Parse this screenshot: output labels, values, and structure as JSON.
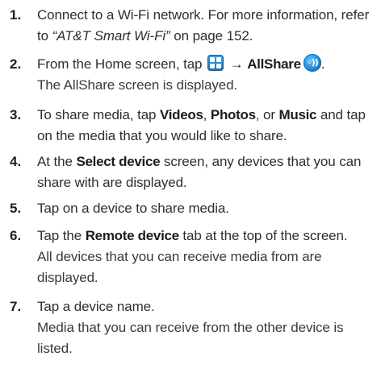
{
  "steps": [
    {
      "number": "1.",
      "line1": "Connect to a Wi-Fi network. For more information, refer",
      "line2_prefix": "to ",
      "line2_link": "“AT&T Smart Wi-Fi”",
      "line2_suffix": " on page 152."
    },
    {
      "number": "2.",
      "pre": "From the Home screen, tap ",
      "arrow": "→",
      "allshare": "AllShare",
      "allshare_icon_text": "◦))",
      "post": ".",
      "note": "The AllShare screen is displayed."
    },
    {
      "number": "3.",
      "line1_pre": "To share media, tap ",
      "videos": "Videos",
      "comma1": ", ",
      "photos": "Photos",
      "or": ", or ",
      "music": "Music",
      "line1_post": " and tap",
      "line2": "on the media that you would like to share."
    },
    {
      "number": "4.",
      "line1_pre": "At the ",
      "select_device": "Select device",
      "line1_post": " screen, any devices that you can",
      "line2": "share with are displayed."
    },
    {
      "number": "5.",
      "line1": "Tap on a device to share media."
    },
    {
      "number": "6.",
      "line1_pre": "Tap the ",
      "remote_device": "Remote device",
      "line1_post": " tab at the top of the screen.",
      "note1": "All devices that you can receive media from are",
      "note2": "displayed."
    },
    {
      "number": "7.",
      "line1": "Tap a device name.",
      "note1": "Media that you can receive from the other device is",
      "note2": "listed."
    }
  ],
  "icons": {
    "apps_icon_color": "#1a6fb8",
    "allshare_icon_color": "#137bd0"
  }
}
